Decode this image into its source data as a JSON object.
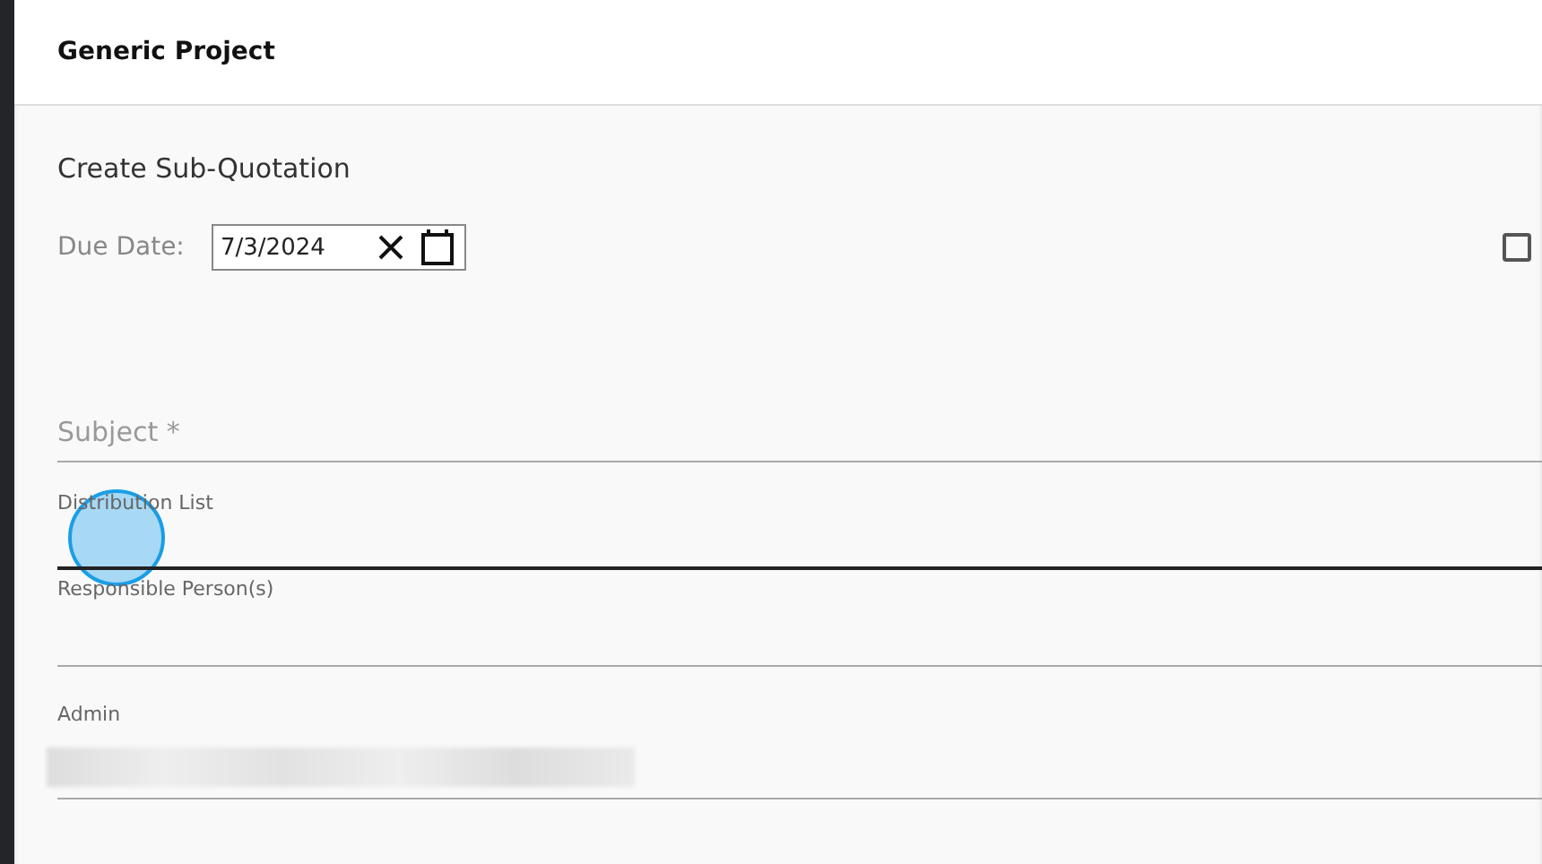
{
  "header": {
    "title": "Generic Project"
  },
  "form": {
    "heading": "Create Sub-Quotation",
    "due_date": {
      "label": "Due Date:",
      "value": "7/3/2024"
    },
    "checkbox": {
      "checked": false
    },
    "fields": [
      {
        "kind": "input",
        "placeholder": "Subject *",
        "focused": false
      },
      {
        "kind": "labeled",
        "label": "Distribution List",
        "focused": true
      },
      {
        "kind": "labeled",
        "label": "Responsible Person(s)",
        "focused": false
      },
      {
        "kind": "redacted",
        "label": "Admin",
        "focused": false
      }
    ]
  }
}
